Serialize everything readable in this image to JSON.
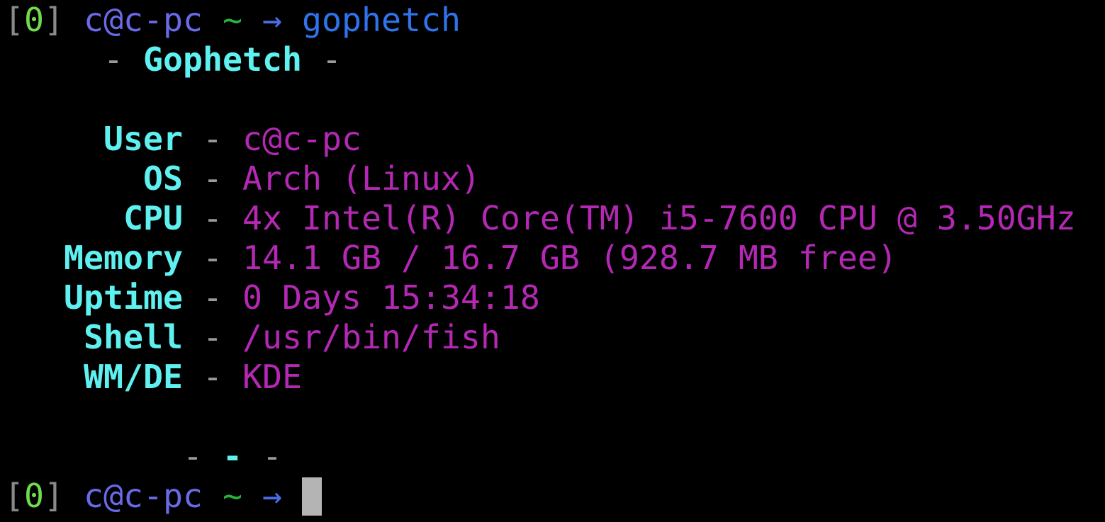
{
  "prompt1": {
    "open_bracket": "[",
    "status": "0",
    "close_bracket": "]",
    "user_host": "c@c-pc",
    "dir": "~",
    "arrow": "→",
    "command": "gophetch"
  },
  "header": {
    "left_dash": "-",
    "title": "Gophetch",
    "right_dash": "-"
  },
  "info": [
    {
      "label": "User",
      "separator": "-",
      "value": "c@c-pc"
    },
    {
      "label": "OS",
      "separator": "-",
      "value": "Arch (Linux)"
    },
    {
      "label": "CPU",
      "separator": "-",
      "value": "4x Intel(R) Core(TM) i5-7600 CPU @ 3.50GHz"
    },
    {
      "label": "Memory",
      "separator": "-",
      "value": "14.1 GB / 16.7 GB (928.7 MB free)"
    },
    {
      "label": "Uptime",
      "separator": "-",
      "value": "0 Days 15:34:18"
    },
    {
      "label": "Shell",
      "separator": "-",
      "value": "/usr/bin/fish"
    },
    {
      "label": "WM/DE",
      "separator": "-",
      "value": "KDE"
    }
  ],
  "footer": {
    "dash1": "-",
    "dash2": "-",
    "dash3": "-"
  },
  "prompt2": {
    "open_bracket": "[",
    "status": "0",
    "close_bracket": "]",
    "user_host": "c@c-pc",
    "dir": "~",
    "arrow": "→"
  },
  "colors": {
    "background": "#000000",
    "label": "#5ff0f0",
    "value": "#b428b4",
    "status": "#6fdc4b",
    "user_host": "#6a6ae8",
    "command": "#2f74ec"
  }
}
